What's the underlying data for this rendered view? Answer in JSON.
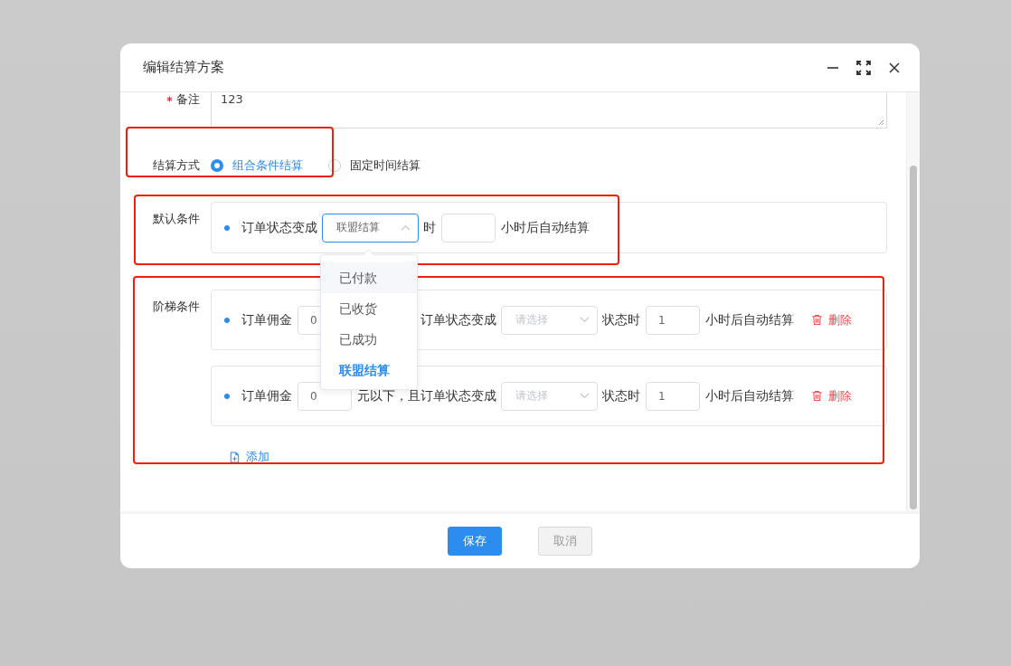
{
  "dialog": {
    "title": "编辑结算方案"
  },
  "remark": {
    "label": "备注",
    "required": true,
    "value": "123"
  },
  "settlement_method": {
    "label": "结算方式",
    "options": [
      {
        "label": "组合条件结算",
        "selected": true
      },
      {
        "label": "固定时间结算",
        "selected": false
      }
    ]
  },
  "default_condition": {
    "label": "默认条件",
    "prefix": "订单状态变成",
    "select": {
      "value": "联盟结算",
      "open": true,
      "options": [
        {
          "label": "已付款",
          "hovered": true,
          "selected": false
        },
        {
          "label": "已收货",
          "hovered": false,
          "selected": false
        },
        {
          "label": "已成功",
          "hovered": false,
          "selected": false
        },
        {
          "label": "联盟结算",
          "hovered": false,
          "selected": true
        }
      ]
    },
    "middle": "时",
    "suffix": "小时后自动结算"
  },
  "ladder_conditions": {
    "label": "阶梯条件",
    "rows": [
      {
        "prefix": "订单佣金",
        "amount": "0",
        "middle": "订单状态变成",
        "status_placeholder": "请选择",
        "status_label": "状态时",
        "hours": "1",
        "suffix": "小时后自动结算",
        "delete": "删除"
      },
      {
        "prefix": "订单佣金",
        "amount": "0",
        "middle": "元以下，且订单状态变成",
        "status_placeholder": "请选择",
        "status_label": "状态时",
        "hours": "1",
        "suffix": "小时后自动结算",
        "delete": "删除"
      }
    ],
    "add": "添加"
  },
  "footer": {
    "buttons": [
      {
        "label": "保存",
        "kind": "primary"
      },
      {
        "label": "取消",
        "kind": "disabled"
      }
    ]
  }
}
